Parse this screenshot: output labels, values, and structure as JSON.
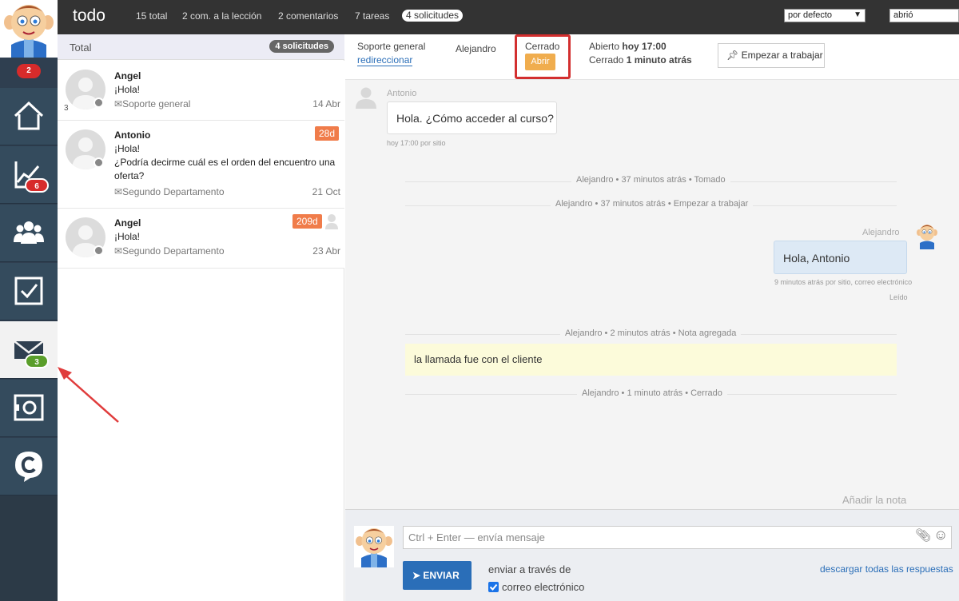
{
  "colors": {
    "sidebar": "#2f3f50",
    "topbar": "#333333",
    "accent_blue": "#2a6eb8",
    "age_badge": "#f07c4a",
    "open_button": "#f0ad4e",
    "highlight_red": "#d32f2f",
    "note_bg": "#fcfbda",
    "out_bubble": "#dde9f5"
  },
  "sidebar": {
    "top_badge": "2",
    "items": [
      {
        "icon": "home-icon"
      },
      {
        "icon": "chart-icon",
        "badge": "6"
      },
      {
        "icon": "users-icon"
      },
      {
        "icon": "checkbox-icon"
      },
      {
        "icon": "mail-icon",
        "badge": "3",
        "active": true
      },
      {
        "icon": "safe-icon"
      },
      {
        "icon": "chat-c-icon"
      }
    ]
  },
  "topbar": {
    "title": "todo",
    "links": [
      "15 total",
      "2 com. a la lección",
      "2 comentarios",
      "7 tareas",
      "4 solicitudes"
    ],
    "sort_value": "por defecto",
    "filter_value": "abrió"
  },
  "list": {
    "header_title": "Total",
    "header_badge": "4 solicitudes",
    "items": [
      {
        "name": "Angel",
        "text": "¡Hola!",
        "department": "Soporte general",
        "date": "14 Abr",
        "count": "3"
      },
      {
        "name": "Antonio",
        "text": "¡Hola!\n¿Podría decirme cuál es el orden del encuentro una oferta?",
        "department": "Segundo Departamento",
        "date": "21 Oct",
        "age": "28d"
      },
      {
        "name": "Angel",
        "text": "¡Hola!",
        "department": "Segundo Departamento",
        "date": "23 Abr",
        "age": "209d"
      }
    ]
  },
  "detail": {
    "department": "Soporte general",
    "redirect_link": "redireccionar",
    "assignee": "Alejandro",
    "status": "Cerrado",
    "open_button": "Abrir",
    "opened_label": "Abierto",
    "opened_value": "hoy 17:00",
    "closed_label": "Cerrado",
    "closed_value": "1 minuto atrás",
    "work_button": "Empezar a trabajar"
  },
  "conversation": {
    "in_author": "Antonio",
    "in_text": "Hola. ¿Cómo acceder al curso?",
    "in_meta": "hoy 17:00 por sitio",
    "events": [
      "Alejandro • 37 minutos atrás • Tomado",
      "Alejandro • 37 minutos atrás • Empezar a trabajar"
    ],
    "out_author": "Alejandro",
    "out_text": "Hola, Antonio",
    "out_meta": "9 minutos atrás por sitio, correo electrónico",
    "out_read": "Leído",
    "note_event": "Alejandro • 2 minutos atrás • Nota agregada",
    "note_text": "la llamada fue con el cliente",
    "closed_event": "Alejandro • 1 minuto atrás • Cerrado",
    "add_note": "Añadir la nota"
  },
  "composer": {
    "placeholder": "Ctrl + Enter — envía mensaje",
    "send_label": "ENVIAR",
    "send_via": "enviar a través de",
    "email_option": "correo electrónico",
    "download_link": "descargar todas las respuestas"
  }
}
